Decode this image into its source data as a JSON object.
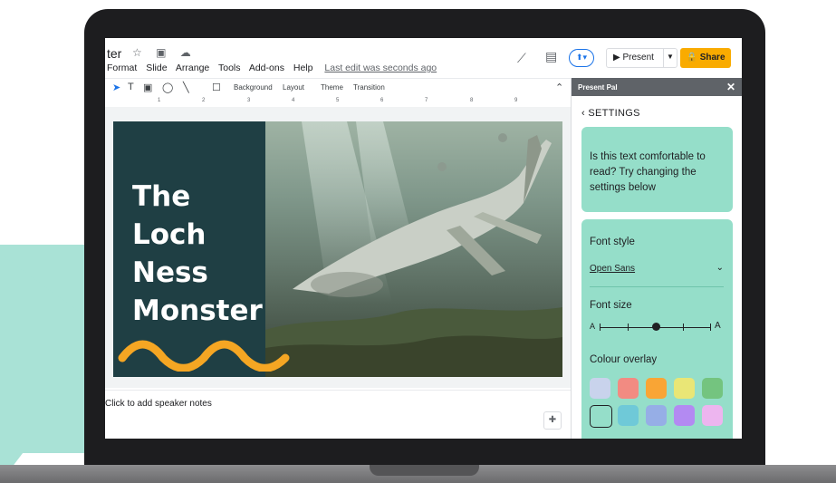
{
  "app": {
    "doc_title_fragment": "ter",
    "title_icons": "☆ ▣ ☁",
    "menus": [
      "Format",
      "Slide",
      "Arrange",
      "Tools",
      "Add-ons",
      "Help"
    ],
    "last_edit": "Last edit was seconds ago",
    "present_label": "Present",
    "share_label": "Share"
  },
  "toolbar": {
    "background": "Background",
    "layout": "Layout",
    "theme": "Theme",
    "transition": "Transition"
  },
  "ruler": [
    "1",
    "2",
    "3",
    "4",
    "5",
    "6",
    "7",
    "8",
    "9"
  ],
  "slide": {
    "title_lines": [
      "The",
      "Loch",
      "Ness",
      "Monster"
    ]
  },
  "notes": {
    "placeholder": "Click to add speaker notes"
  },
  "panel": {
    "title": "Present Pal",
    "close": "✕",
    "back_label": "SETTINGS",
    "prompt": "Is this text comfortable to read? Try changing the settings below",
    "font_style_label": "Font style",
    "font_style_value": "Open Sans",
    "font_size_label": "Font size",
    "font_size_min": "A",
    "font_size_max": "A",
    "font_size_level": 0.5,
    "colour_overlay_label": "Colour overlay",
    "swatches": [
      "#c9d3ec",
      "#f28b82",
      "#f9a535",
      "#e9e676",
      "#74c47f",
      "#95dec9",
      "#6fc9d8",
      "#96aee6",
      "#b38af2",
      "#edb5ef"
    ]
  },
  "colors": {
    "share": "#f9ab00",
    "panel_card": "#95dec9",
    "slide_panel": "#1f3f44",
    "accent": "#1a73e8"
  }
}
